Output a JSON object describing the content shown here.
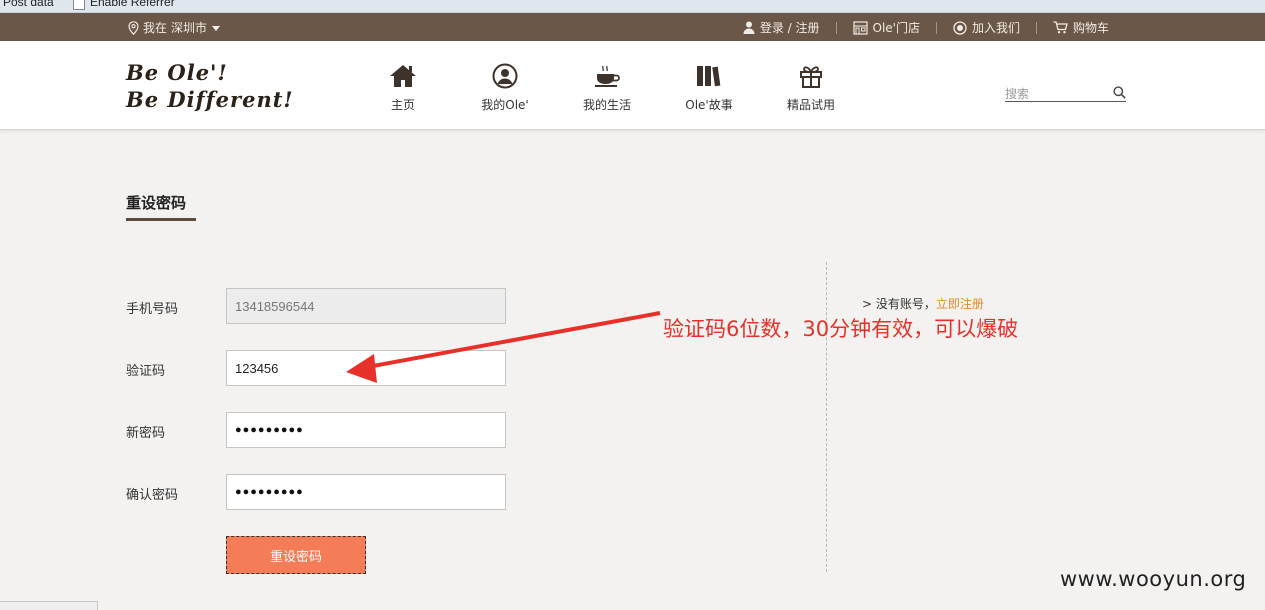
{
  "addon_bar": {
    "post_data": "Post data",
    "enable_referrer": "Enable Referrer"
  },
  "topbar": {
    "city_prefix": "我在",
    "city": "深圳市",
    "links": [
      "登录 / 注册",
      "Ole'门店",
      "加入我们",
      "购物车"
    ]
  },
  "header": {
    "logo_line1": "Be Ole'!",
    "logo_line2": "Be Different!",
    "nav": [
      "主页",
      "我的Ole'",
      "我的生活",
      "Ole'故事",
      "精品试用"
    ],
    "search_placeholder": "搜索"
  },
  "page": {
    "title": "重设密码"
  },
  "form": {
    "phone_label": "手机号码",
    "phone_value": "13418596544",
    "code_label": "验证码",
    "code_value": "123456",
    "new_pwd_label": "新密码",
    "new_pwd_mask": "●●●●●●●●●",
    "confirm_pwd_label": "确认密码",
    "confirm_pwd_mask": "●●●●●●●●●",
    "submit_label": "重设密码"
  },
  "side": {
    "no_account": "> 没有账号，",
    "register_now": "立即注册"
  },
  "annotation": "验证码6位数，30分钟有效，可以爆破",
  "watermark": "www.wooyun.org",
  "colors": {
    "topbar": "#6b5747",
    "accent_orange": "#f47c56",
    "annotation_red": "#e8302a",
    "link_orange": "#e28a2b"
  }
}
